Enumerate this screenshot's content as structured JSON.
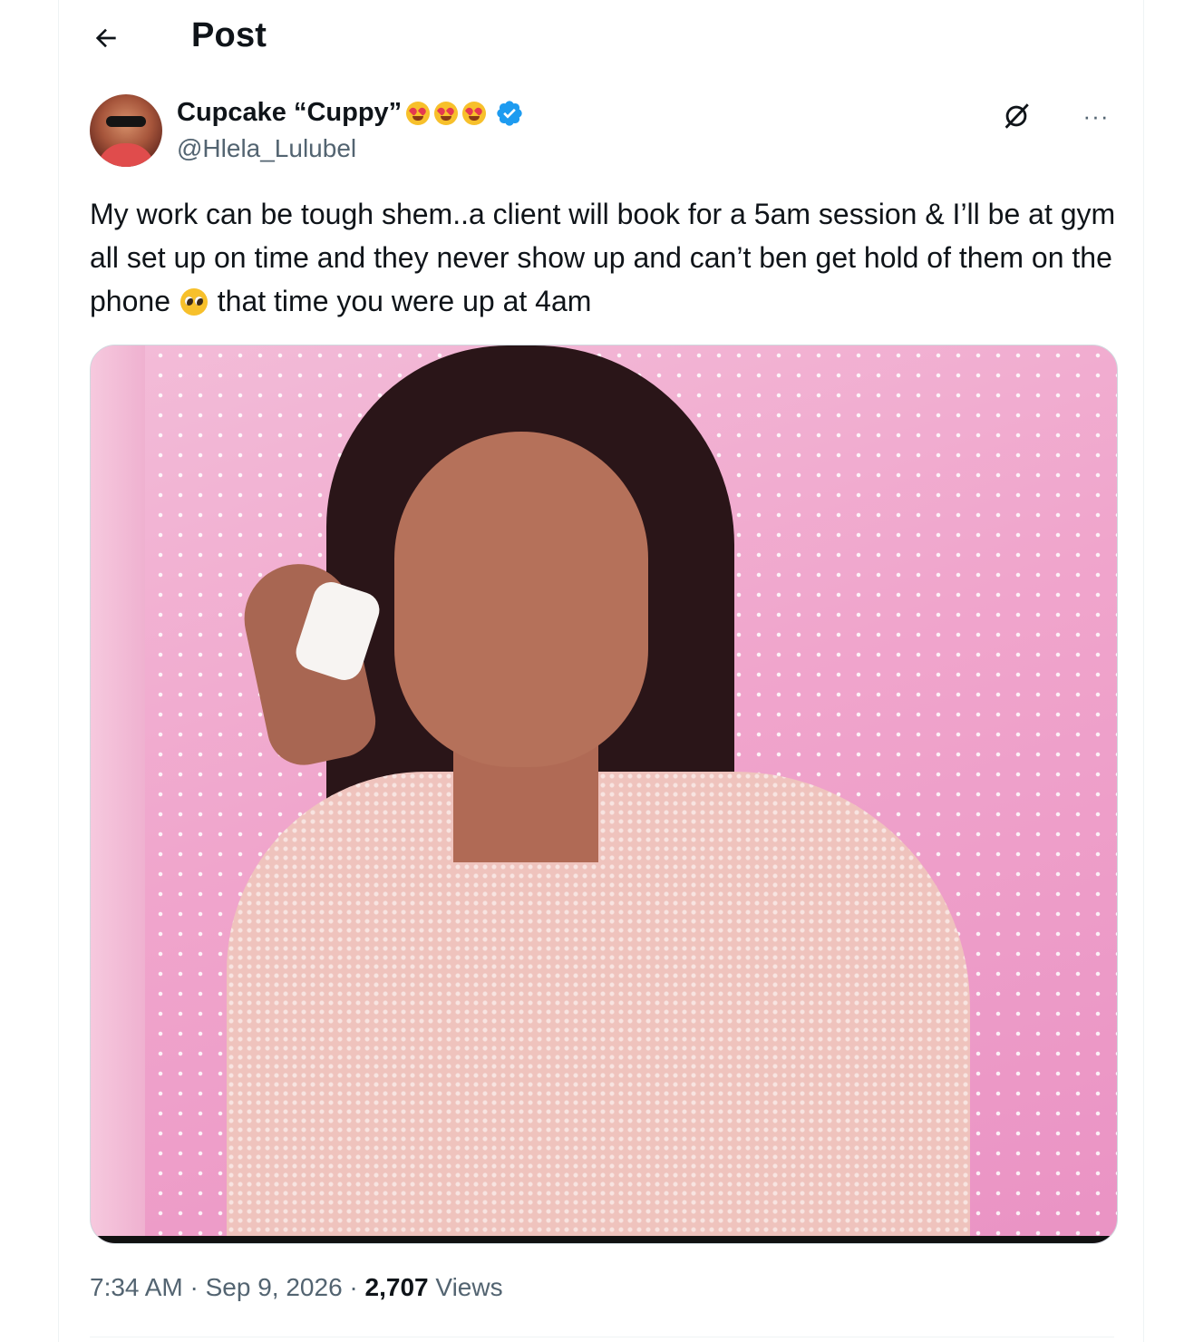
{
  "header": {
    "title": "Post",
    "back_icon": "arrow-left-icon"
  },
  "author": {
    "display_name": "Cupcake “Cuppy”",
    "emojis": [
      "smiling-face-with-heart-eyes",
      "smiling-face-with-heart-eyes",
      "smiling-face-with-heart-eyes"
    ],
    "verified": true,
    "verified_color": "#1d9bf0",
    "handle": "@Hlela_Lulubel"
  },
  "actions": {
    "grok_icon": "grok-icon",
    "more_icon": "more-horizontal-icon",
    "more_label": "···"
  },
  "tweet": {
    "text_before_emoji": "My work can be tough shem..a client will book for a 5am session & I’ll be at gym all set up on time and they never show up and can’t ben get hold of them on the phone ",
    "inline_emoji": "pleading-face",
    "text_after_emoji": " that time you were up at 4am"
  },
  "media": {
    "type": "photo"
  },
  "meta": {
    "time": "7:34 AM",
    "separator": " · ",
    "date": "Sep 9, 2026",
    "views_count": "2,707",
    "views_label": "Views"
  },
  "colors": {
    "text_primary": "#0f1419",
    "text_secondary": "#536471",
    "border": "#eff3f4",
    "accent": "#1d9bf0"
  }
}
